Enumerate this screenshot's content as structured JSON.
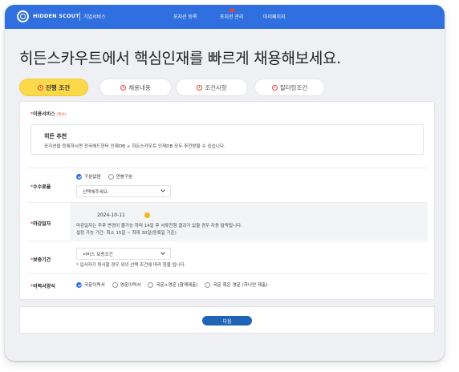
{
  "header": {
    "brand": "HIDDEN SCOUT",
    "sub": "기업서비스",
    "nav": [
      "포지션 등록",
      "포지션 관리",
      "마이페이지"
    ]
  },
  "page": {
    "title": "히든스카우트에서 핵심인재를 빠르게 채용해보세요."
  },
  "tabs": [
    {
      "label": "진행 조건",
      "active": true
    },
    {
      "label": "채용내용",
      "active": false
    },
    {
      "label": "조건사항",
      "active": false
    },
    {
      "label": "필터링조건",
      "active": false
    }
  ],
  "form": {
    "service": {
      "label": "이용서비스",
      "required": "(필수)",
      "title": "히든 추천",
      "desc": "포지션을 등록하시면 전국헤드헌터 인재DB + 히든스카우트 인재DB 모두 추천받을 수 있습니다."
    },
    "fee": {
      "label": "수수료율",
      "options": [
        "구분없음",
        "연봉구분"
      ],
      "select_value": "선택해주세요."
    },
    "deadline": {
      "label": "마감일자",
      "date": "2024-10-11",
      "note1": "마감일자는 추후 변경이 불가능 하며 14일 후 서류전형 결과가 없을 경우 자동 탈락됩니다.",
      "note2": "설정 가능 기간: 최소 15일 ~ 최대 30일(등록일 기준)"
    },
    "guarantee": {
      "label": "보증기간",
      "select_value": "서비스 보증조건",
      "note": "* 입사자가 퇴사할 경우 위의 선택 조건에 따라 환불 됩니다."
    },
    "resume": {
      "label": "이력서양식",
      "options": [
        "국문이력서",
        "영문이력서",
        "국문+영문 (함께제출)",
        "국문 혹은 영문 (하나만 제출)"
      ]
    }
  },
  "footer": {
    "next_label": "다음"
  },
  "colors": {
    "primary": "#2f6fe0",
    "accent_tab": "#fbd94a",
    "required": "#e5433a",
    "button": "#1e63b5"
  }
}
